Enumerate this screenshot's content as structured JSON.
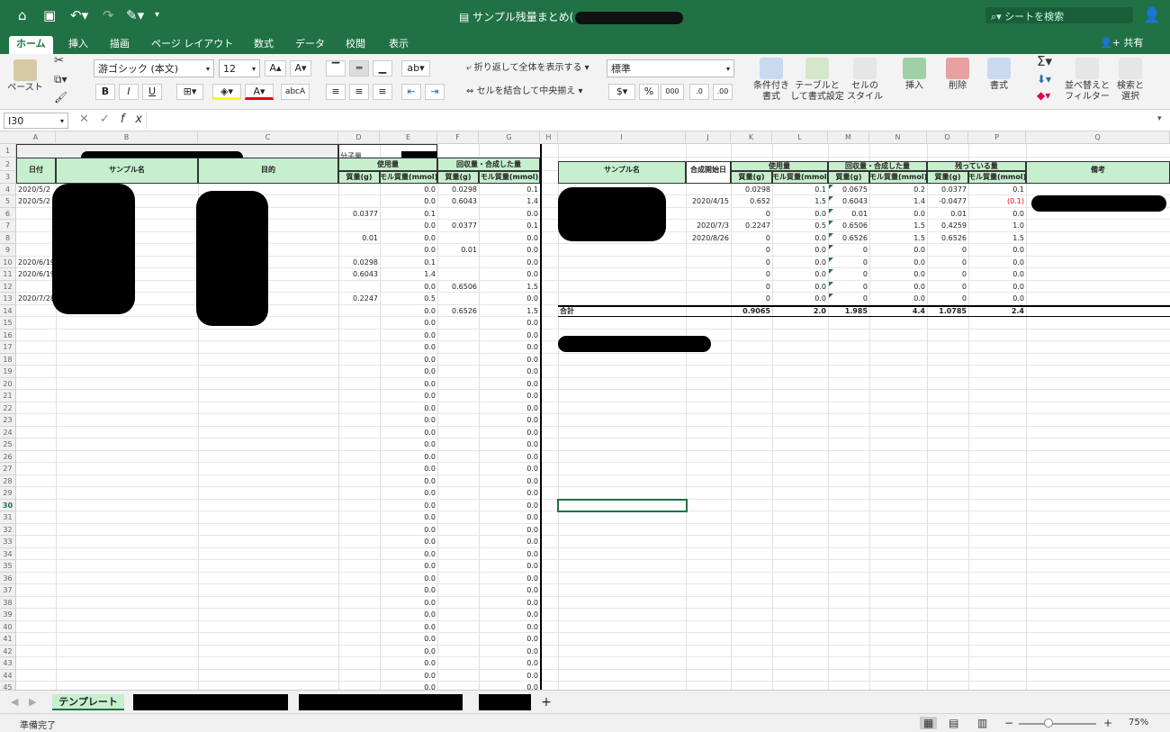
{
  "app": {
    "title": "サンプル残量まとめ(",
    "search_placeholder": "シートを検索",
    "share": "共有",
    "accent": "#207245"
  },
  "tabs": [
    "ホーム",
    "挿入",
    "描画",
    "ページ レイアウト",
    "数式",
    "データ",
    "校閲",
    "表示"
  ],
  "ribbon": {
    "paste": "ペースト",
    "font": "游ゴシック (本文)",
    "size": "12",
    "wrap": "折り返して全体を表示する",
    "merge": "セルを結合して中央揃え",
    "format": "標準",
    "cond": "条件付き\n書式",
    "table": "テーブルと\nして書式設定",
    "styles": "セルの\nスタイル",
    "insert": "挿入",
    "delete": "削除",
    "fmt": "書式",
    "sort": "並べ替えと\nフィルター",
    "find": "検索と\n選択",
    "bold": "B",
    "italic": "I",
    "underline": "U",
    "percent": "%",
    "thousand": "000"
  },
  "formula": {
    "namebox": "I30",
    "fx": "fx"
  },
  "cols": [
    "A",
    "B",
    "C",
    "D",
    "E",
    "F",
    "G",
    "H",
    "I",
    "J",
    "K",
    "L",
    "M",
    "N",
    "O",
    "P",
    "Q"
  ],
  "left": {
    "mw": "分子量",
    "date": "日付",
    "sample": "サンプル名",
    "purpose": "目的",
    "used": "使用量",
    "recov": "回収量・合成した量",
    "mass": "質量(g)",
    "mol": "モル質量(mmol)",
    "rows": [
      [
        "2020/5/2",
        "",
        "0.0",
        "0.0298",
        "0.1"
      ],
      [
        "2020/5/2",
        "",
        "0.0",
        "0.6043",
        "1.4"
      ],
      [
        "",
        "0.0377",
        "0.1",
        "",
        "0.0"
      ],
      [
        "",
        "",
        "0.0",
        "0.0377",
        "0.1"
      ],
      [
        "",
        "0.01",
        "0.0",
        "",
        "0.0"
      ],
      [
        "",
        "",
        "0.0",
        "0.01",
        "0.0"
      ],
      [
        "2020/6/19",
        "0.0298",
        "0.1",
        "",
        "0.0"
      ],
      [
        "2020/6/19",
        "0.6043",
        "1.4",
        "",
        "0.0"
      ],
      [
        "",
        "",
        "0.0",
        "0.6506",
        "1.5"
      ],
      [
        "2020/7/28",
        "0.2247",
        "0.5",
        "",
        "0.0"
      ],
      [
        "",
        "",
        "0.0",
        "0.6526",
        "1.5"
      ]
    ],
    "zero": "0.0"
  },
  "right": {
    "sample": "サンプル名",
    "start": "合成開始日",
    "used": "使用量",
    "recov": "回収量・合成した量",
    "remain": "残っている量",
    "note": "備考",
    "mass": "質量(g)",
    "mol": "モル質量(mmol)",
    "rows": [
      [
        "",
        "0.0298",
        "0.1",
        "0.0675",
        "0.2",
        "0.0377",
        "0.1"
      ],
      [
        "2020/4/15",
        "0.652",
        "1.5",
        "0.6043",
        "1.4",
        "-0.0477",
        "(0.1)"
      ],
      [
        "",
        "0",
        "0.0",
        "0.01",
        "0.0",
        "0.01",
        "0.0"
      ],
      [
        "2020/7/3",
        "0.2247",
        "0.5",
        "0.6506",
        "1.5",
        "0.4259",
        "1.0"
      ],
      [
        "2020/8/26",
        "0",
        "0.0",
        "0.6526",
        "1.5",
        "0.6526",
        "1.5"
      ],
      [
        "",
        "0",
        "0.0",
        "0",
        "0.0",
        "0",
        "0.0"
      ],
      [
        "",
        "0",
        "0.0",
        "0",
        "0.0",
        "0",
        "0.0"
      ],
      [
        "",
        "0",
        "0.0",
        "0",
        "0.0",
        "0",
        "0.0"
      ],
      [
        "",
        "0",
        "0.0",
        "0",
        "0.0",
        "0",
        "0.0"
      ],
      [
        "",
        "0",
        "0.0",
        "0",
        "0.0",
        "0",
        "0.0"
      ]
    ],
    "total_label": "合計",
    "totals": [
      "0.9065",
      "2.0",
      "1.985",
      "4.4",
      "1.0785",
      "2.4"
    ]
  },
  "sheets": {
    "first": "テンプレート",
    "add": "+"
  },
  "status": {
    "ready": "準備完了",
    "zoom": "75%"
  }
}
